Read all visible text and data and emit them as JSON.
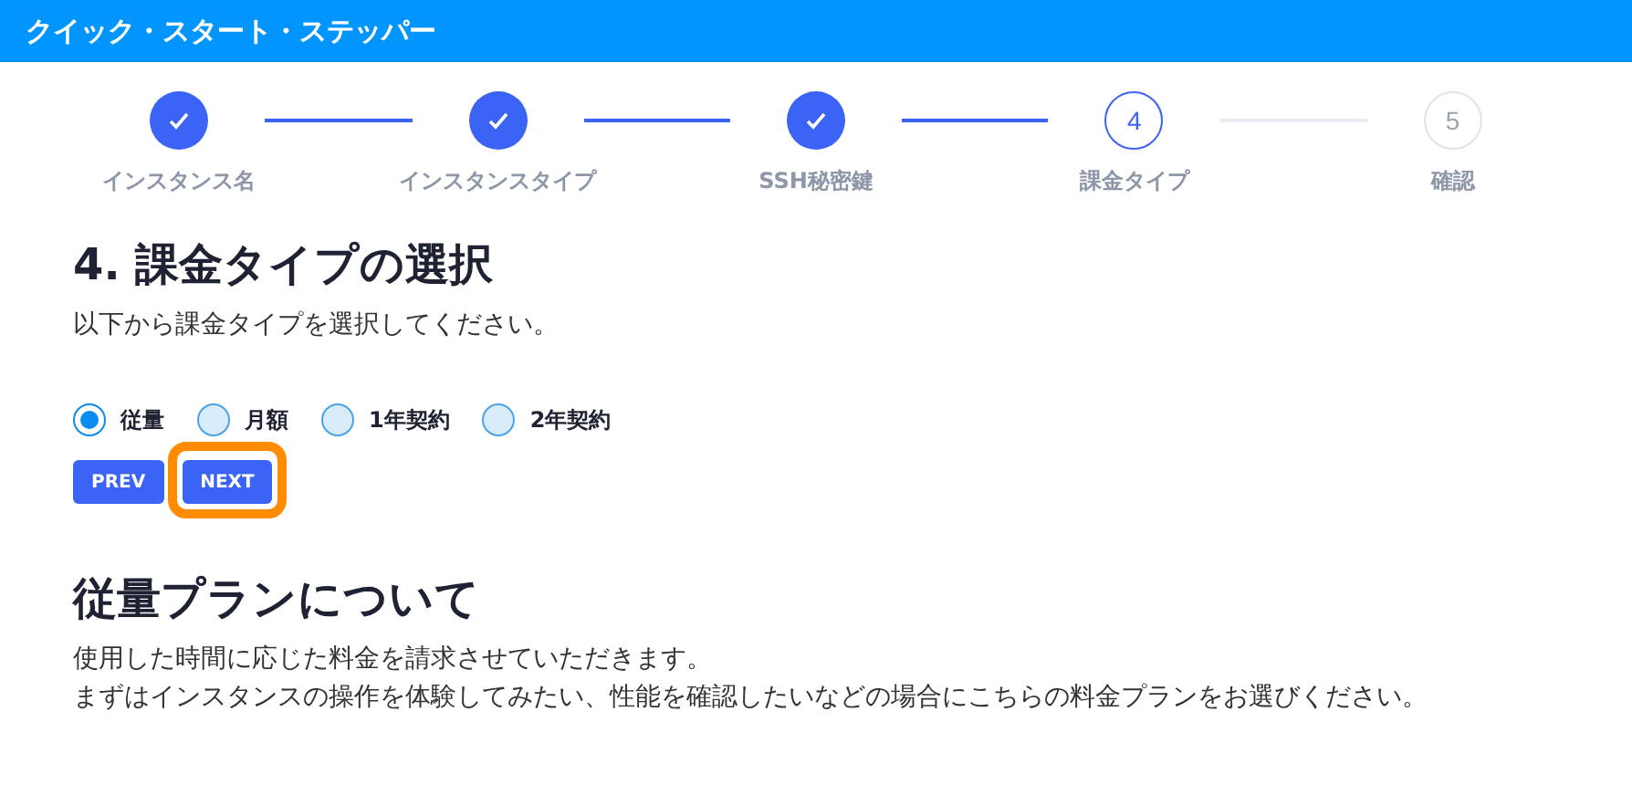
{
  "header": {
    "title": "クイック・スタート・ステッパー"
  },
  "steps": [
    {
      "label": "インスタンス名",
      "kind": "done"
    },
    {
      "label": "インスタンスタイプ",
      "kind": "done"
    },
    {
      "label": "SSH秘密鍵",
      "kind": "done"
    },
    {
      "number": "4",
      "label": "課金タイプ",
      "kind": "current"
    },
    {
      "number": "5",
      "label": "確認",
      "kind": "upcoming"
    }
  ],
  "section": {
    "title": "4. 課金タイプの選択",
    "description": "以下から課金タイプを選択してください。"
  },
  "options": [
    {
      "label": "従量",
      "selected": true
    },
    {
      "label": "月額",
      "selected": false
    },
    {
      "label": "1年契約",
      "selected": false
    },
    {
      "label": "2年契約",
      "selected": false
    }
  ],
  "buttons": [
    {
      "label": "PREV",
      "highlighted": false
    },
    {
      "label": "NEXT",
      "highlighted": true
    }
  ],
  "plan": {
    "title": "従量プランについて",
    "lines": [
      "使用した時間に応じた料金を請求させていただきます。",
      "まずはインスタンスの操作を体験してみたい、性能を確認したいなどの場合にこちらの料金プランをお選びください。"
    ]
  }
}
